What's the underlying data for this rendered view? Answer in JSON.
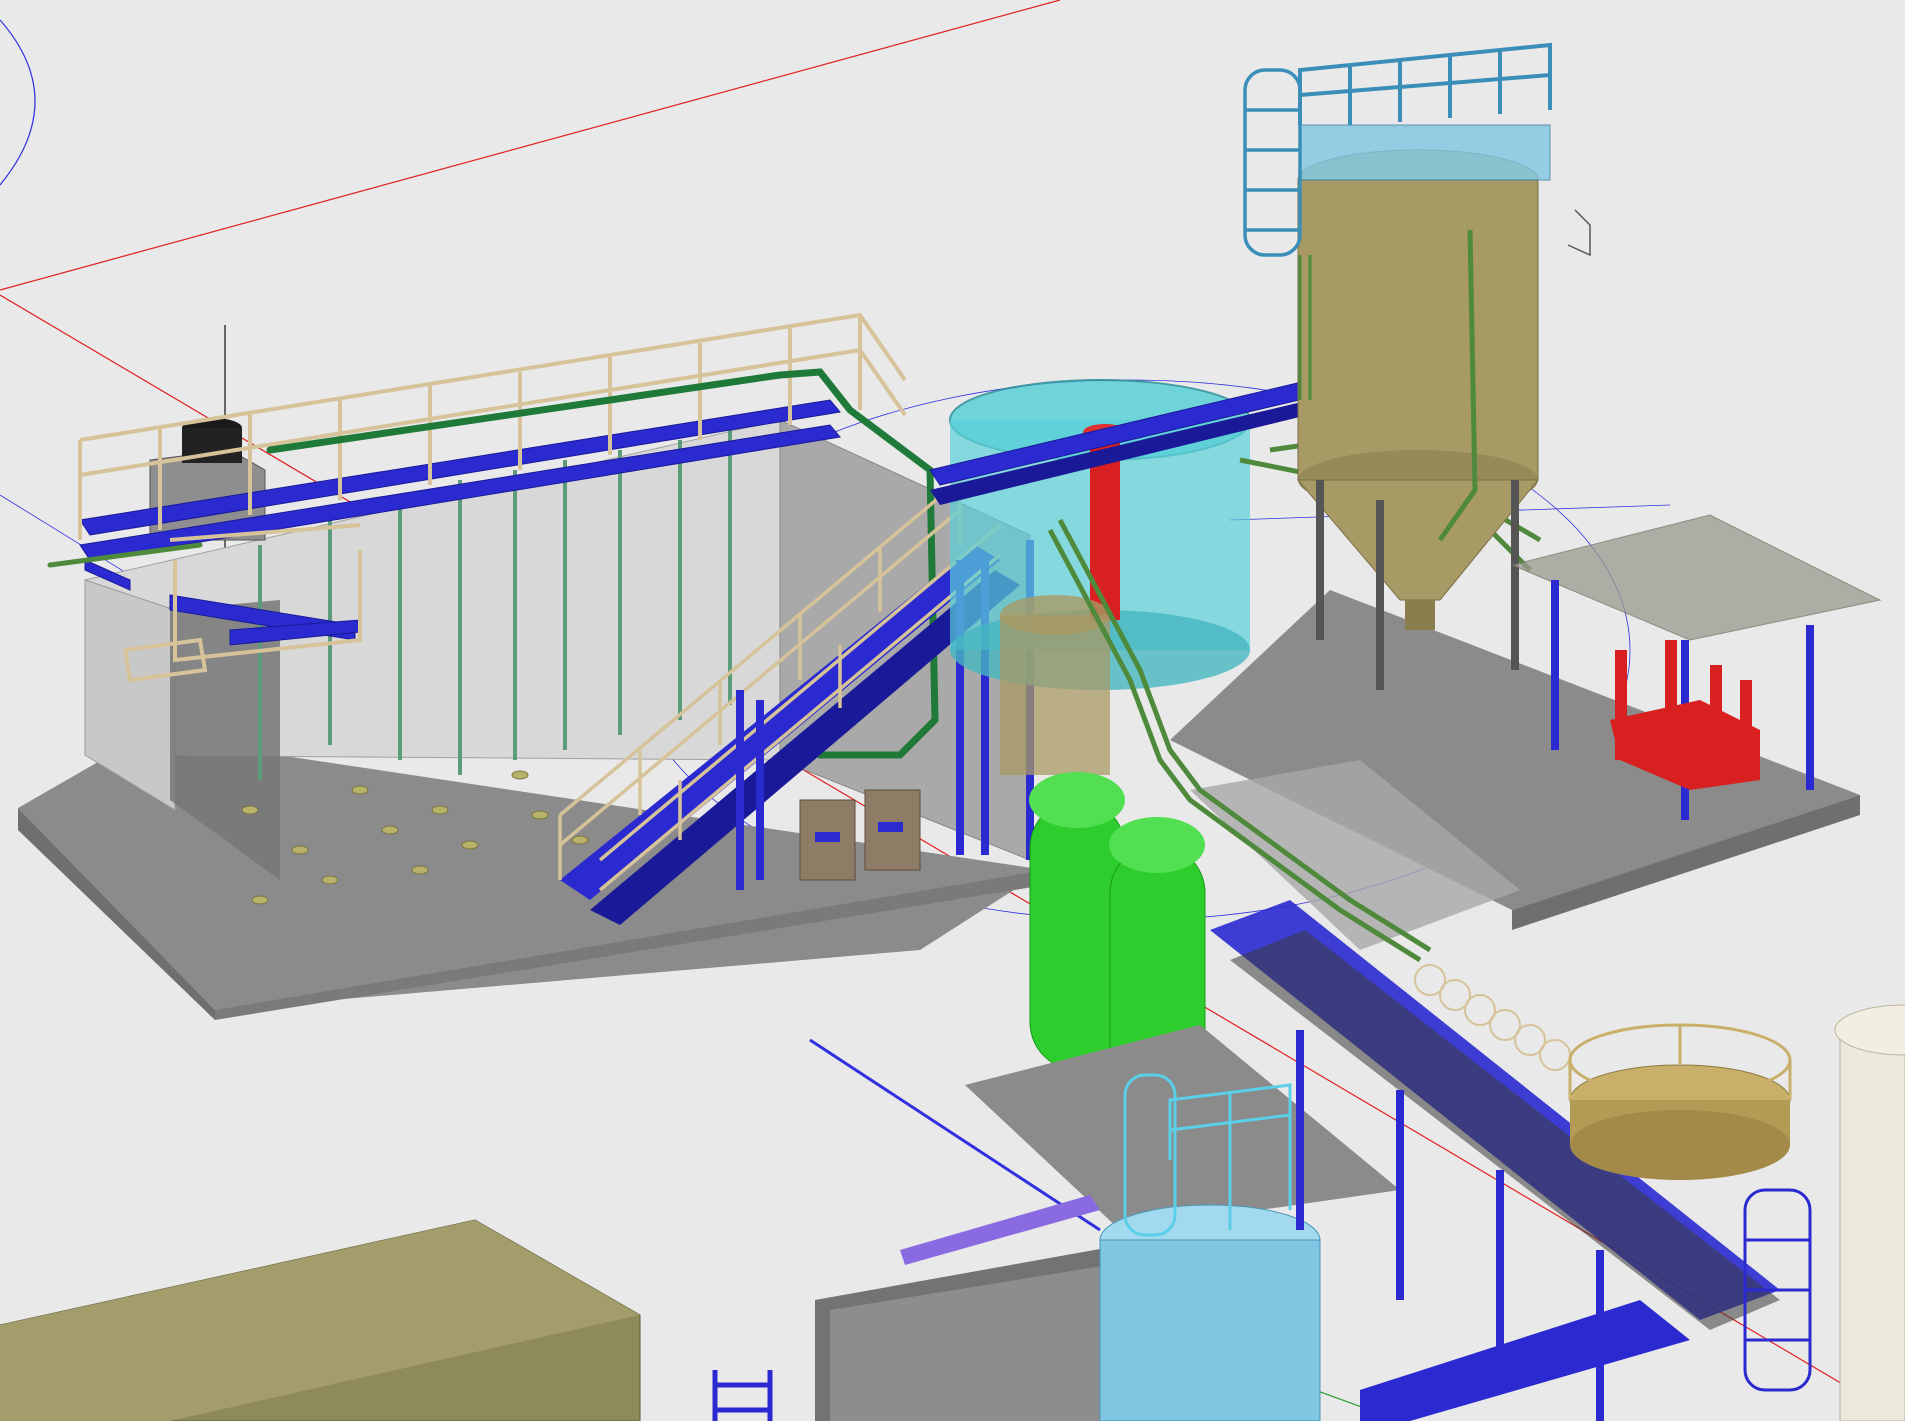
{
  "viewport": {
    "background": "#e9e9e9"
  },
  "palette": {
    "steel_blue": "#2a2ad0",
    "steel_blue_dark": "#1a1a99",
    "handrail_tan": "#d6c39a",
    "pipe_green": "#4f8a3c",
    "pipe_green_dark": "#1f7a3a",
    "concrete": "#8b8b8b",
    "concrete_dark": "#6f6f6f",
    "wall_light": "#d8d8d8",
    "silo_olive": "#a89a64",
    "tank_cyan": "#5ad0d8",
    "vessel_green": "#2ccd2c",
    "tank_light_blue": "#7ec6e2",
    "red_equipment": "#d82020",
    "building_olive": "#8f8a5a",
    "axis_red": "#e02020",
    "axis_blue": "#3030e0",
    "canopy_gray": "#9a9a90",
    "small_tank_tan": "#c9b06a"
  },
  "icons": {
    "view_cube": "view-cube-icon",
    "ucs": "ucs-axis-icon"
  }
}
